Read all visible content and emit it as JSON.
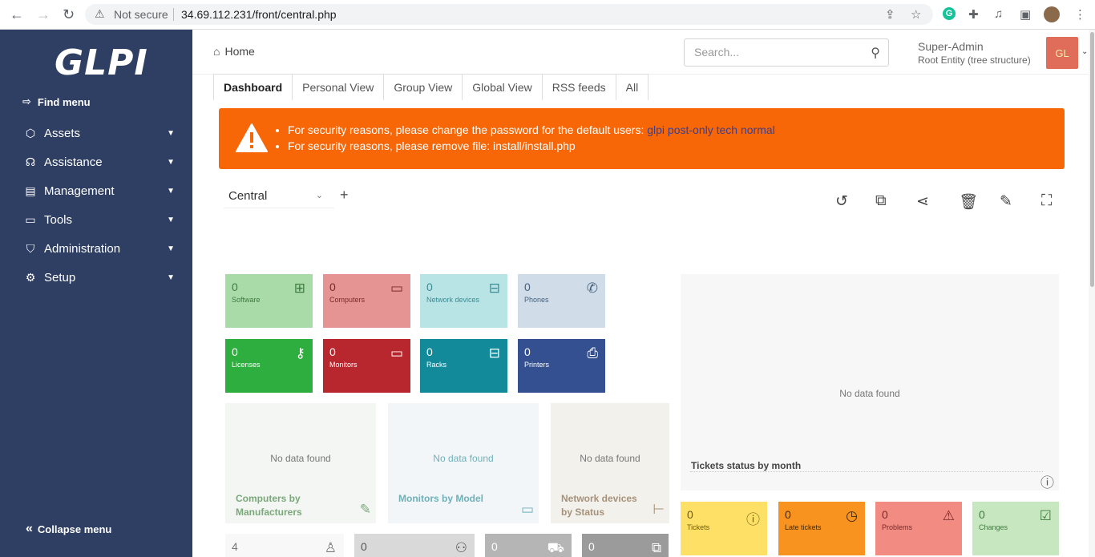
{
  "browser": {
    "security_label": "Not secure",
    "url": "34.69.112.231/front/central.php"
  },
  "sidebar": {
    "logo": "GLPI",
    "find_menu": "Find menu",
    "items": [
      {
        "label": "Assets",
        "icon": "box-icon"
      },
      {
        "label": "Assistance",
        "icon": "headset-icon"
      },
      {
        "label": "Management",
        "icon": "wallet-icon"
      },
      {
        "label": "Tools",
        "icon": "briefcase-icon"
      },
      {
        "label": "Administration",
        "icon": "shield-icon"
      },
      {
        "label": "Setup",
        "icon": "gear-icon"
      }
    ],
    "collapse_menu": "Collapse menu"
  },
  "header": {
    "breadcrumb": "Home",
    "search_placeholder": "Search...",
    "user_name": "Super-Admin",
    "entity": "Root Entity (tree structure)",
    "avatar_initials": "GL"
  },
  "tabs": [
    "Dashboard",
    "Personal View",
    "Group View",
    "Global View",
    "RSS feeds",
    "All"
  ],
  "alert": {
    "line1_text": "For security reasons, please change the password for the default users:",
    "line1_users": "glpi post-only tech normal",
    "line2_text": "For security reasons, please remove file: install/install.php"
  },
  "dashboard": {
    "selected": "Central"
  },
  "cards_row1": [
    {
      "value": "0",
      "label": "Software",
      "bg": "#a8dba8",
      "fg": "#3f7a3f"
    },
    {
      "value": "0",
      "label": "Computers",
      "bg": "#e69393",
      "fg": "#7a2a2a"
    },
    {
      "value": "0",
      "label": "Network devices",
      "bg": "#b8e4e6",
      "fg": "#3a8c94"
    },
    {
      "value": "0",
      "label": "Phones",
      "bg": "#d0dde9",
      "fg": "#44607e"
    }
  ],
  "cards_row2": [
    {
      "value": "0",
      "label": "Licenses",
      "bg": "#2eae3f",
      "fg": "#ffffff"
    },
    {
      "value": "0",
      "label": "Monitors",
      "bg": "#b8272e",
      "fg": "#ffffff"
    },
    {
      "value": "0",
      "label": "Racks",
      "bg": "#128a99",
      "fg": "#ffffff"
    },
    {
      "value": "0",
      "label": "Printers",
      "bg": "#345091",
      "fg": "#ffffff"
    }
  ],
  "widgets": {
    "no_data": "No data found",
    "computers_title": "Computers by Manufacturers",
    "monitors_title": "Monitors by Model",
    "network_title": "Network devices by Status",
    "tickets_month_title": "Tickets status by month"
  },
  "ticket_cards": [
    {
      "value": "0",
      "label": "Tickets",
      "bg": "#ffe066",
      "fg": "#6b5a10"
    },
    {
      "value": "0",
      "label": "Late tickets",
      "bg": "#f7931e",
      "fg": "#4a2a00"
    },
    {
      "value": "0",
      "label": "Problems",
      "bg": "#f28b82",
      "fg": "#7a2a2a"
    },
    {
      "value": "0",
      "label": "Changes",
      "bg": "#c7e7c0",
      "fg": "#3f7a3f"
    }
  ],
  "bottom_cards": [
    {
      "value": "4",
      "bg": "#f8f8f8",
      "fg": "#777"
    },
    {
      "value": "0",
      "bg": "#d9d9d9",
      "fg": "#555"
    },
    {
      "value": "0",
      "bg": "#b5b5b5",
      "fg": "#fff"
    },
    {
      "value": "0",
      "bg": "#9b9b9b",
      "fg": "#fff"
    }
  ]
}
